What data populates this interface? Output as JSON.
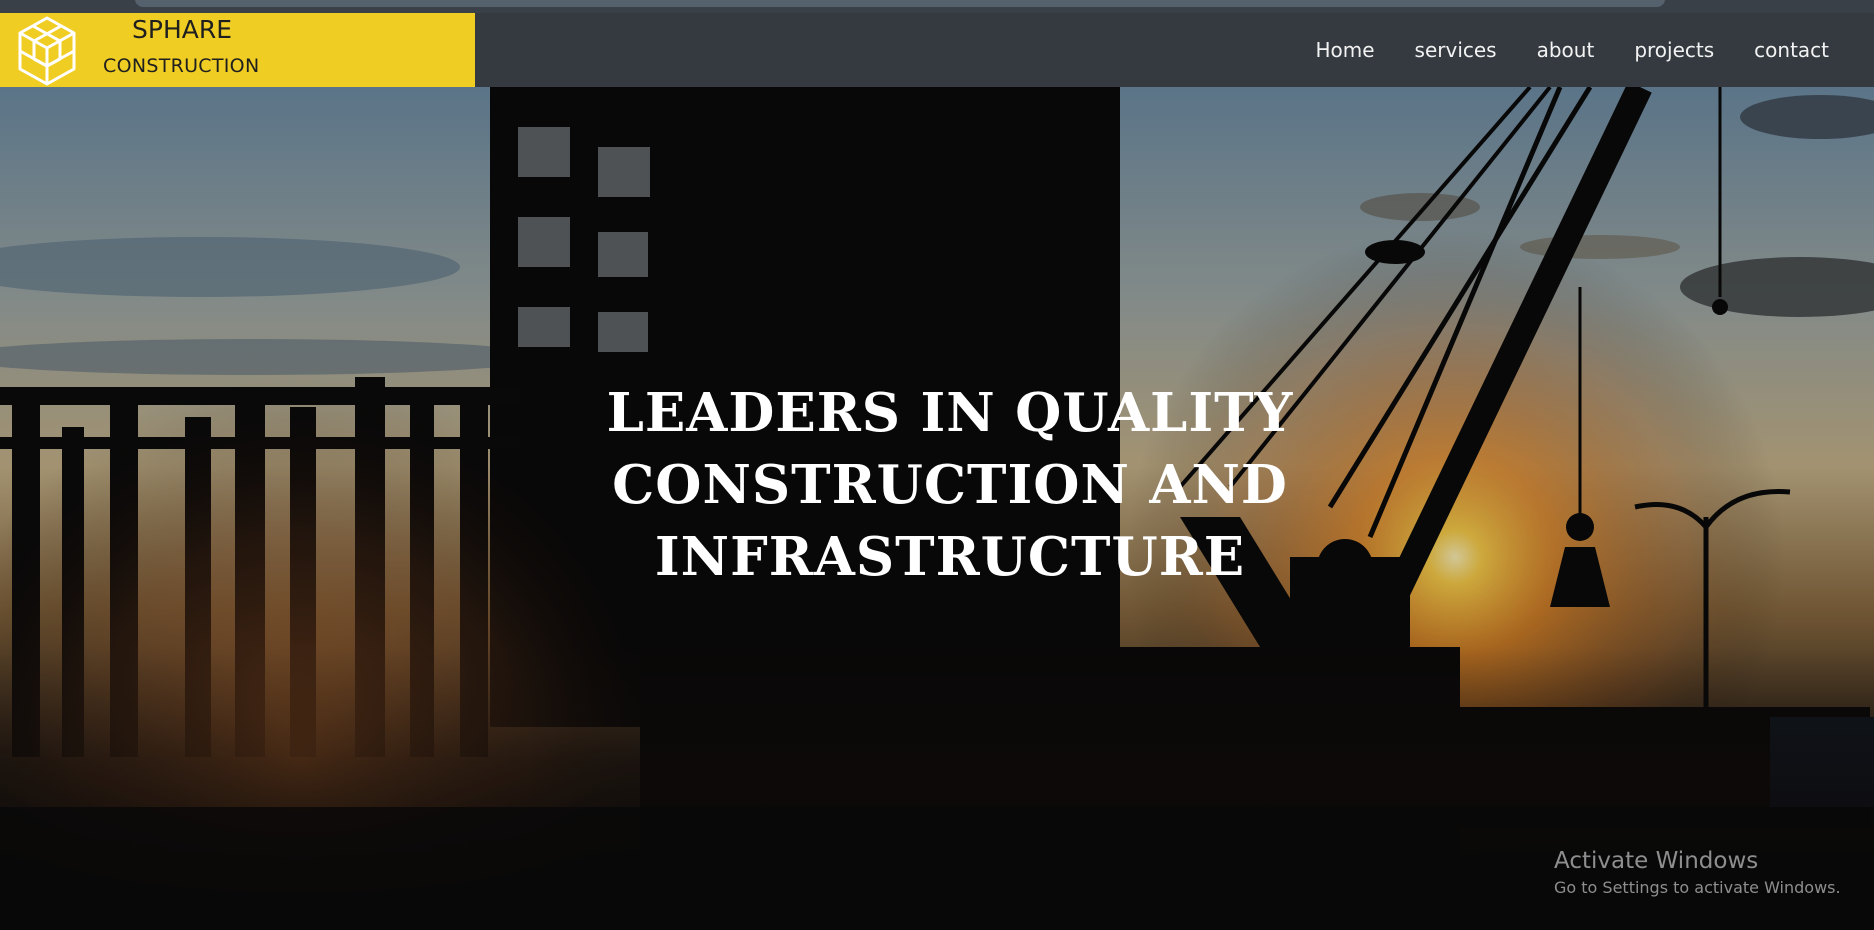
{
  "brand": {
    "name": "SPHARE",
    "subtitle": "CONSTRUCTION",
    "logo_icon": "hexagon-cube-logo",
    "color": "#f0cd23"
  },
  "nav": {
    "items": [
      {
        "label": "Home"
      },
      {
        "label": "services"
      },
      {
        "label": "about"
      },
      {
        "label": "projects"
      },
      {
        "label": "contact"
      }
    ],
    "background": "#343a40"
  },
  "hero": {
    "title_lines": [
      "LEADERS IN QUALITY",
      "CONSTRUCTION AND",
      "INFRASTRUCTURE"
    ]
  },
  "watermark": {
    "line1": "Activate Windows",
    "line2": "Go to Settings to activate Windows."
  }
}
